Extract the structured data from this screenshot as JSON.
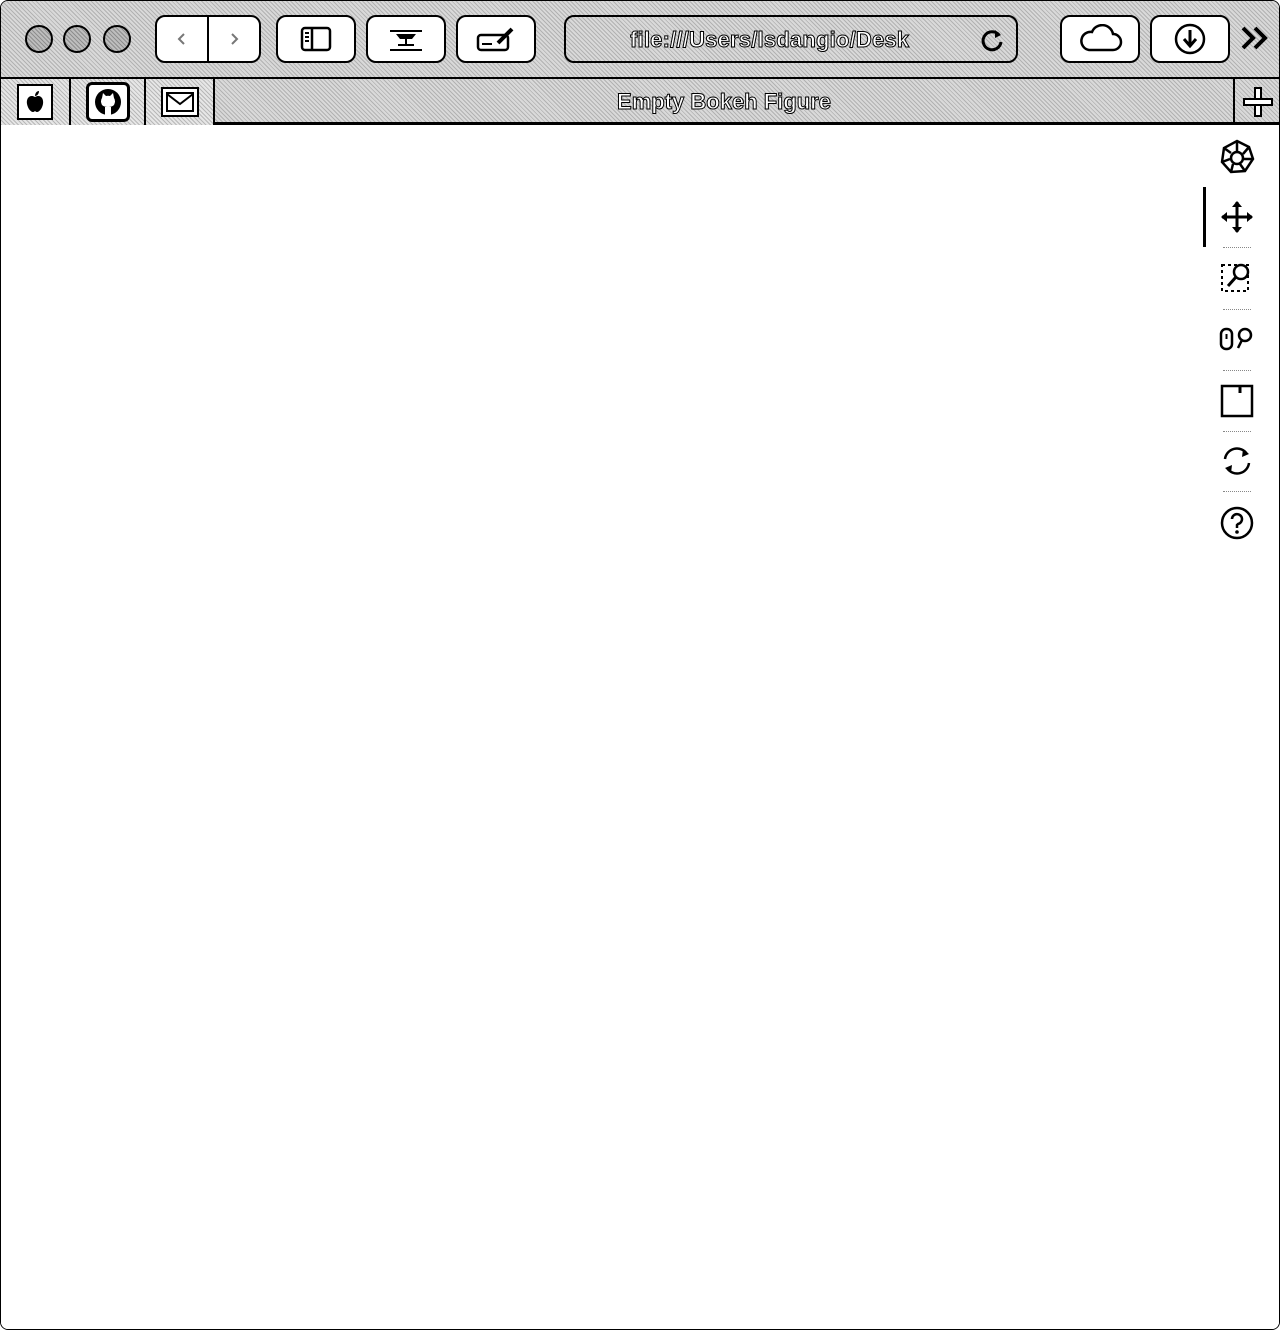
{
  "browser": {
    "url": "file:///Users/lsdangio/Desk",
    "tab_title": "Empty Bokeh Figure",
    "pinned_tabs": [
      "apple-icon",
      "github-icon",
      "mail-icon"
    ]
  },
  "bokeh_toolbar": {
    "tools": [
      "bokeh-logo-icon",
      "pan-icon",
      "box-zoom-icon",
      "wheel-zoom-icon",
      "save-icon",
      "reset-icon",
      "help-icon"
    ],
    "active_tool": "pan-icon"
  }
}
